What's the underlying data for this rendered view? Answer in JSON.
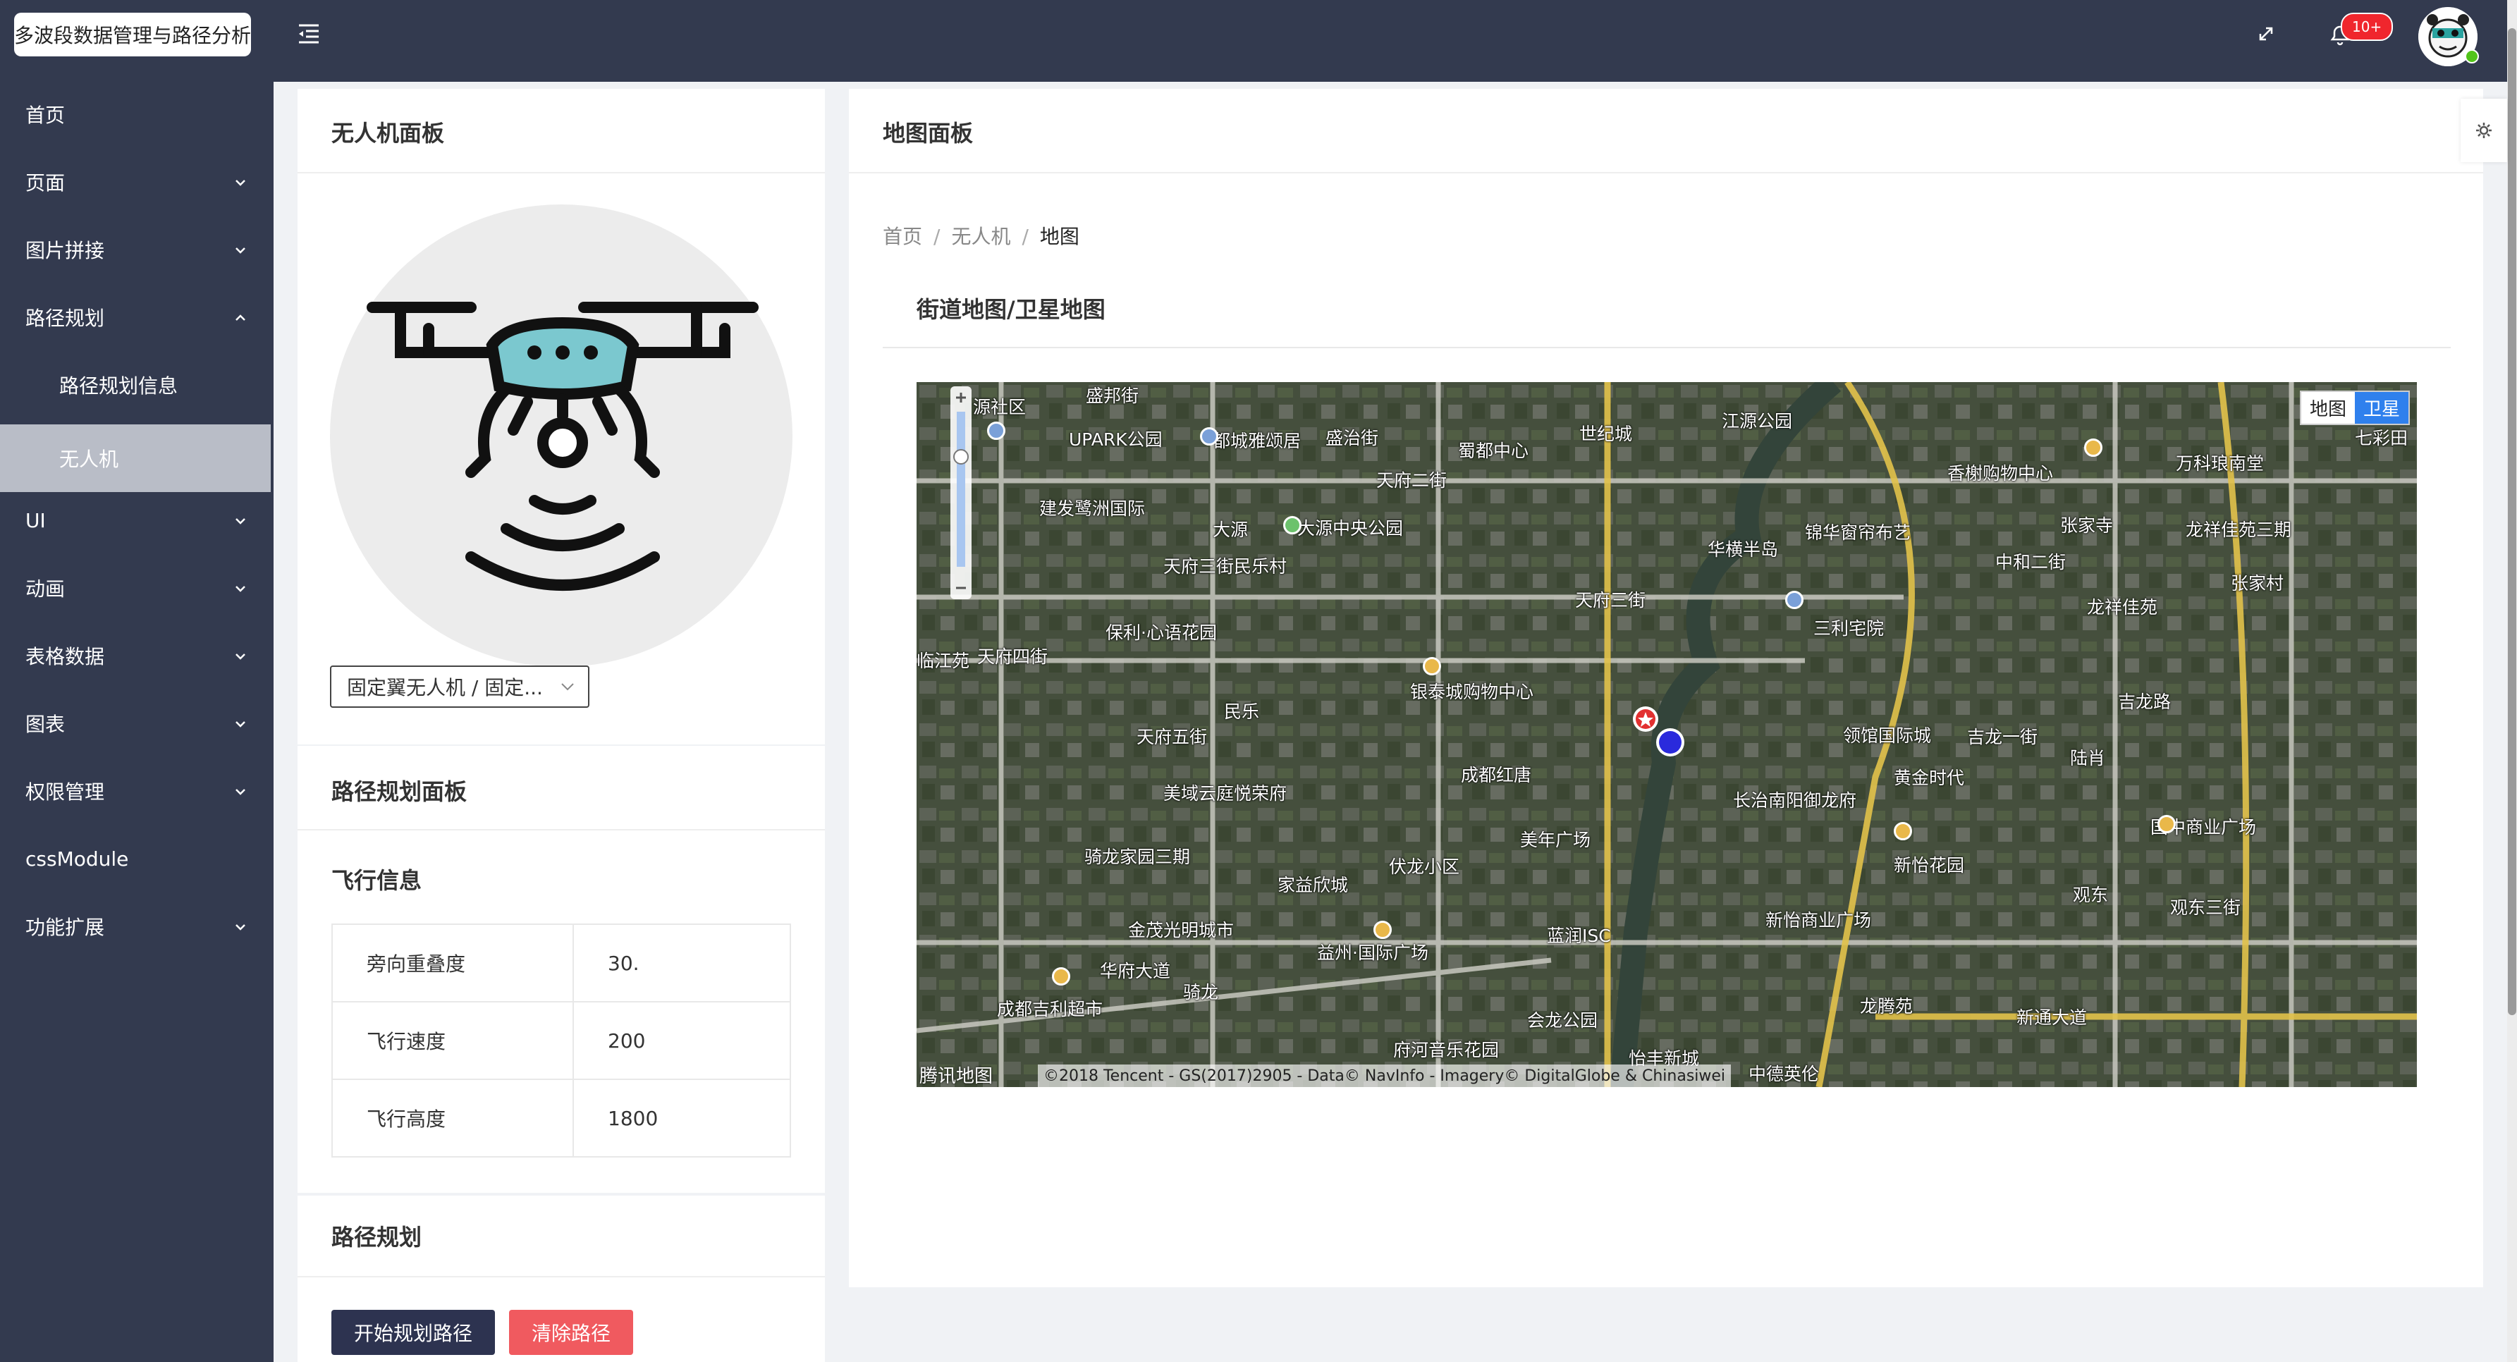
{
  "app": {
    "title": "多波段数据管理与路径分析"
  },
  "sidebar": {
    "items": [
      {
        "label": "首页"
      },
      {
        "label": "页面"
      },
      {
        "label": "图片拼接"
      },
      {
        "label": "路径规划"
      },
      {
        "label": "路径规划信息"
      },
      {
        "label": "无人机"
      },
      {
        "label": "UI"
      },
      {
        "label": "动画"
      },
      {
        "label": "表格数据"
      },
      {
        "label": "图表"
      },
      {
        "label": "权限管理"
      },
      {
        "label": "cssModule"
      },
      {
        "label": "功能扩展"
      }
    ],
    "active_item": "无人机"
  },
  "header": {
    "icons": [
      "menu-fold-icon",
      "fullscreen-icon",
      "notification-icon"
    ],
    "notification_badge": "10+"
  },
  "drone_panel": {
    "title": "无人机面板",
    "select_value": "固定翼无人机 / 固定...",
    "image_icon": "drone-icon"
  },
  "route_panel": {
    "title": "路径规划面板",
    "flight_info_title": "飞行信息",
    "rows": [
      {
        "key": "旁向重叠度",
        "value": "30."
      },
      {
        "key": "飞行速度",
        "value": "200"
      },
      {
        "key": "飞行高度",
        "value": "1800"
      }
    ],
    "route_title": "路径规划",
    "start_button": "开始规划路径",
    "clear_button": "清除路径",
    "start_button_color": "#2d3350",
    "clear_button_color": "#f05a5f"
  },
  "map_panel": {
    "title": "地图面板",
    "breadcrumb": [
      "首页",
      "无人机",
      "地图"
    ],
    "subtitle": "街道地图/卫星地图",
    "map_type_buttons": [
      "地图",
      "卫星"
    ],
    "selected_map_type": "卫星",
    "copyright": "©2018 Tencent - GS(2017)2905 - Data© NavInfo - Imagery© DigitalGlobe & Chinasiwei",
    "provider_logo": "腾讯地图",
    "labels": [
      "盛邦街",
      "源社区",
      "UPARK公园",
      "都城雅颂居",
      "盛治街",
      "蜀都中心",
      "世纪城",
      "江源公园",
      "香榭购物中心",
      "万科琅南堂",
      "七彩田",
      "建发鹭洲国际",
      "大源中央公园",
      "天府二街",
      "锦华窗帘布艺",
      "张家寺",
      "龙祥佳苑三期",
      "天府三街民乐村",
      "大源",
      "华横半岛",
      "中和二街",
      "张家村",
      "保利·心语花园",
      "天府三街",
      "三利宅院",
      "龙祥佳苑",
      "临江苑",
      "天府四街",
      "银泰城购物中心",
      "吉龙路",
      "民乐",
      "天府五街",
      "领馆国际城",
      "吉龙一街",
      "陆肖",
      "美域云庭悦荣府",
      "成都红唐",
      "长治南阳御龙府",
      "黄金时代",
      "国中商业广场",
      "美年广场",
      "骑龙家园三期",
      "伏龙小区",
      "家益欣城",
      "新怡花园",
      "观东三街",
      "观东",
      "金茂光明城市",
      "益州·国际广场",
      "蓝润ISC",
      "新怡商业广场",
      "华府大道",
      "骑龙",
      "龙腾苑",
      "成都吉利超市",
      "会龙公园",
      "府河音乐花园",
      "新通大道",
      "怡丰新城",
      "中德英伦"
    ]
  },
  "colors": {
    "sidebar_bg": "#333a4f",
    "active_item_bg": "#b9bdc7",
    "badge": "#f0262d",
    "map_type_selected": "#2f80ed"
  }
}
